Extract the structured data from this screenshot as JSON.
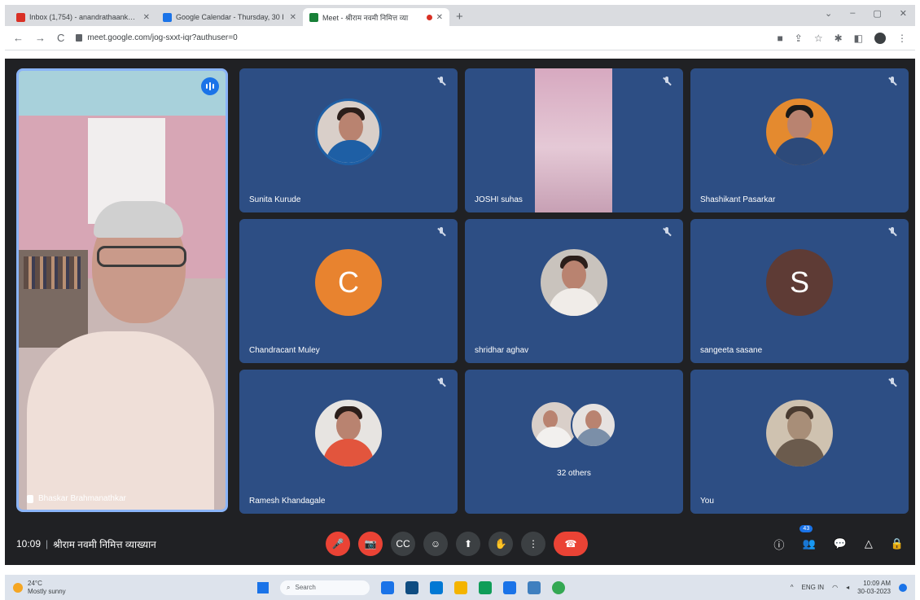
{
  "browser": {
    "tabs": [
      {
        "label": "Inbox (1,754) - anandrathaankar@",
        "icon_color": "#d93025",
        "active": false
      },
      {
        "label": "Google Calendar - Thursday, 30 I",
        "icon_color": "#1a73e8",
        "active": false
      },
      {
        "label": "Meet - श्रीराम नवमी निमित्त व्या",
        "icon_color": "#188038",
        "active": true
      }
    ],
    "new_tab": "+",
    "window_controls": [
      "⌄",
      "–",
      "▢",
      "✕"
    ],
    "url": "meet.google.com/jog-sxxt-iqr?authuser=0",
    "nav": {
      "back": "←",
      "forward": "→",
      "reload": "C"
    }
  },
  "speaker": {
    "name": "Bhaskar Brahmanathkar"
  },
  "tiles": [
    {
      "name": "Sunita Kurude",
      "type": "photo",
      "body_color": "#1e5fa5"
    },
    {
      "name": "JOSHI suhas",
      "type": "video"
    },
    {
      "name": "Shashikant Pasarkar",
      "type": "photo",
      "body_color": "#2d4a7a"
    },
    {
      "name": "Chandracant Muley",
      "type": "letter",
      "letter": "C",
      "color": "#e8832f"
    },
    {
      "name": "shridhar aghav",
      "type": "photo",
      "body_color": "#d8d2ce"
    },
    {
      "name": "sangeeta sasane",
      "type": "letter",
      "letter": "S",
      "color": "#5e3b35"
    },
    {
      "name": "Ramesh Khandagale",
      "type": "photo",
      "body_color": "#e2553d"
    },
    {
      "name": "32 others",
      "type": "others"
    },
    {
      "name": "You",
      "type": "photo",
      "body_color": "#6b5b4d"
    }
  ],
  "bottom": {
    "time": "10:09",
    "separator": "|",
    "title": "श्रीराम नवमी निमित्त व्याख्यान",
    "controls": [
      "🎤",
      "📷",
      "CC",
      "☺",
      "⬆",
      "✋",
      "⋮",
      "☎"
    ],
    "right_controls": [
      "ⓘ",
      "👥",
      "💬",
      "△",
      "🔒"
    ],
    "participants_badge": "43"
  },
  "taskbar": {
    "temp": "24°C",
    "weather": "Mostly sunny",
    "search": "Search",
    "apps_colors": [
      "#1a73e8",
      "#0f4c81",
      "#0078d4",
      "#f4b400",
      "#0f9d58",
      "#1a73e8",
      "#3f7fbf",
      "#34a853"
    ],
    "lang": "ENG IN",
    "clock_time": "10:09 AM",
    "clock_date": "30-03-2023"
  }
}
